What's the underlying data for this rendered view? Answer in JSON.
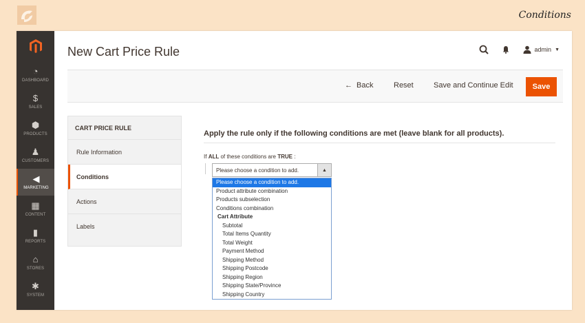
{
  "page_label": "Conditions",
  "nav": [
    {
      "label": "DASHBOARD",
      "icon": "dashboard-icon",
      "glyph": "◔"
    },
    {
      "label": "SALES",
      "icon": "dollar-icon",
      "glyph": "$"
    },
    {
      "label": "PRODUCTS",
      "icon": "cube-icon",
      "glyph": "⬢"
    },
    {
      "label": "CUSTOMERS",
      "icon": "person-icon",
      "glyph": "♟"
    },
    {
      "label": "MARKETING",
      "icon": "megaphone-icon",
      "glyph": "◀"
    },
    {
      "label": "CONTENT",
      "icon": "layout-icon",
      "glyph": "▦"
    },
    {
      "label": "REPORTS",
      "icon": "bar-chart-icon",
      "glyph": "▮"
    },
    {
      "label": "STORES",
      "icon": "store-icon",
      "glyph": "⌂"
    },
    {
      "label": "SYSTEM",
      "icon": "gear-icon",
      "glyph": "✱"
    }
  ],
  "header": {
    "title": "New Cart Price Rule",
    "user": "admin"
  },
  "toolbar": {
    "back": "Back",
    "reset": "Reset",
    "save_continue": "Save and Continue Edit",
    "save": "Save"
  },
  "tabs": {
    "heading": "CART PRICE RULE",
    "items": [
      "Rule Information",
      "Conditions",
      "Actions",
      "Labels"
    ]
  },
  "conditions": {
    "title": "Apply the rule only if the following conditions are met (leave blank for all products).",
    "if_prefix": "If",
    "aggregator": "ALL",
    "mid_text": "of these conditions are",
    "value": "TRUE",
    "suffix": ":",
    "select_value": "Please choose a condition to add.",
    "options": [
      "Please choose a condition to add.",
      "Product attribute combination",
      "Products subselection",
      "Conditions combination",
      "Cart Attribute",
      "Subtotal",
      "Total Items Quantity",
      "Total Weight",
      "Payment Method",
      "Shipping Method",
      "Shipping Postcode",
      "Shipping Region",
      "Shipping State/Province",
      "Shipping Country"
    ]
  }
}
